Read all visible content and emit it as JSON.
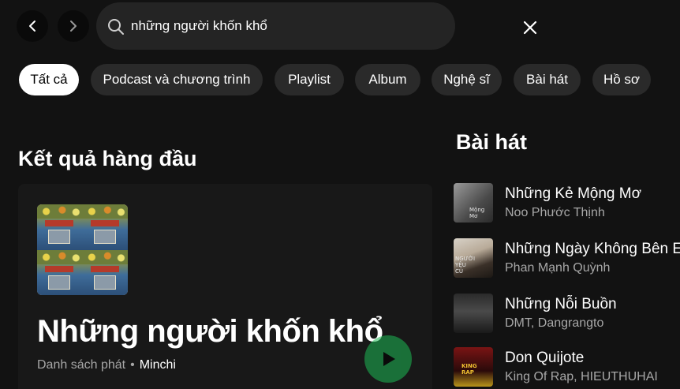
{
  "search": {
    "value": "những người khốn khổ"
  },
  "filters": [
    {
      "label": "Tất cả",
      "active": true
    },
    {
      "label": "Podcast và chương trình",
      "active": false
    },
    {
      "label": "Playlist",
      "active": false
    },
    {
      "label": "Album",
      "active": false
    },
    {
      "label": "Nghệ sĩ",
      "active": false
    },
    {
      "label": "Bài hát",
      "active": false
    },
    {
      "label": "Hồ sơ",
      "active": false
    }
  ],
  "top_result": {
    "heading": "Kết quả hàng đầu",
    "title": "Những người khốn khổ",
    "type_label": "Danh sách phát",
    "separator": "•",
    "owner": "Minchi"
  },
  "songs": {
    "heading": "Bài hát",
    "items": [
      {
        "title": "Những Kẻ Mộng Mơ",
        "artist": "Noo Phước Thịnh",
        "thumb_text": "Mộng Mơ"
      },
      {
        "title": "Những Ngày Không Bên Em",
        "artist": "Phan Mạnh Quỳnh",
        "thumb_text": "NGƯỜI YÊU CŨ"
      },
      {
        "title": "Những Nỗi Buồn",
        "artist": "DMT, Dangrangto",
        "thumb_text": ""
      },
      {
        "title": "Don Quijote",
        "artist": "King Of Rap, HIEUTHUHAI",
        "thumb_text": "KING RAP"
      }
    ]
  },
  "colors": {
    "background": "#121212",
    "card": "#181818",
    "chip": "#2a2a2a",
    "accent": "#1db954",
    "muted": "#a7a7a7"
  },
  "icons": {
    "back": "chevron-left-icon",
    "forward": "chevron-right-icon",
    "search": "search-icon",
    "clear": "close-icon",
    "play": "play-icon"
  }
}
